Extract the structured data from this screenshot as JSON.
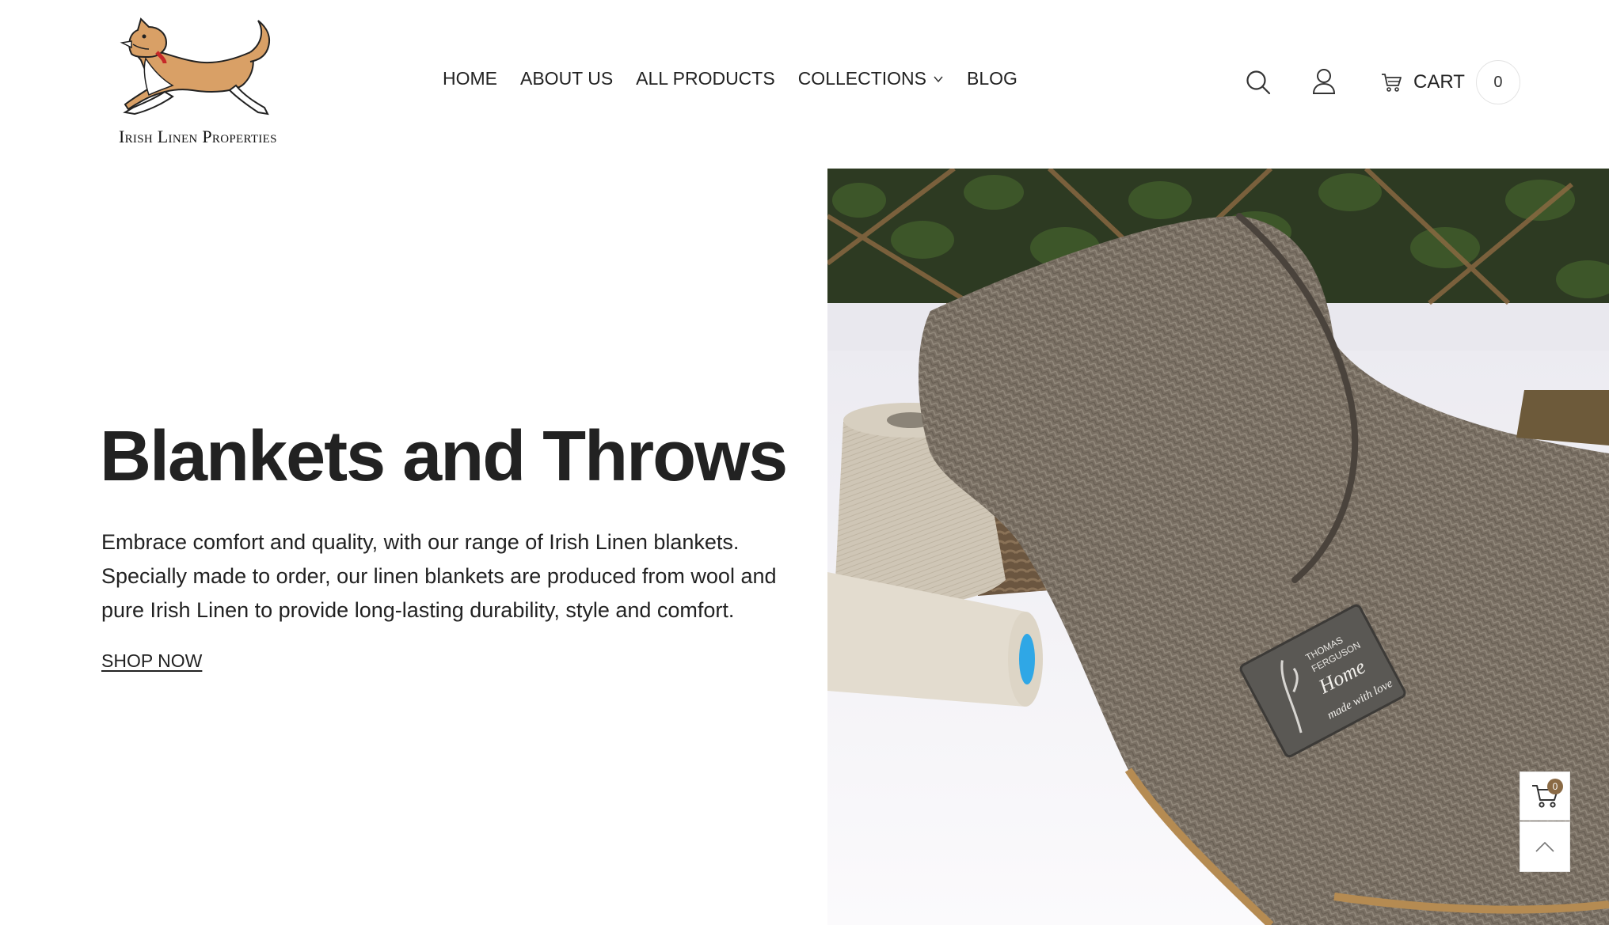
{
  "brand": {
    "name": "Irish Linen Properties",
    "logo_icon": "jumping-dog-logo"
  },
  "nav": {
    "items": [
      {
        "label": "HOME"
      },
      {
        "label": "ABOUT US"
      },
      {
        "label": "ALL PRODUCTS"
      },
      {
        "label": "COLLECTIONS",
        "has_dropdown": true
      },
      {
        "label": "BLOG"
      }
    ]
  },
  "header_actions": {
    "search_icon": "search-icon",
    "account_icon": "user-icon",
    "cart_label": "CART",
    "cart_count": "0"
  },
  "hero": {
    "title": "Blankets and Throws",
    "description": "Embrace comfort and quality, with our range of Irish Linen blankets. Specially made to order, our linen blankets are produced from wool and pure Irish Linen to provide long-lasting durability, style and comfort.",
    "cta_label": "SHOP NOW",
    "image_label": {
      "line1": "THOMAS",
      "line2": "FERGUSON",
      "line3": "Home",
      "line4": "made with love"
    }
  },
  "floating": {
    "cart_badge": "0"
  },
  "colors": {
    "text": "#222222",
    "badge": "#8a6a45",
    "background": "#ffffff"
  }
}
